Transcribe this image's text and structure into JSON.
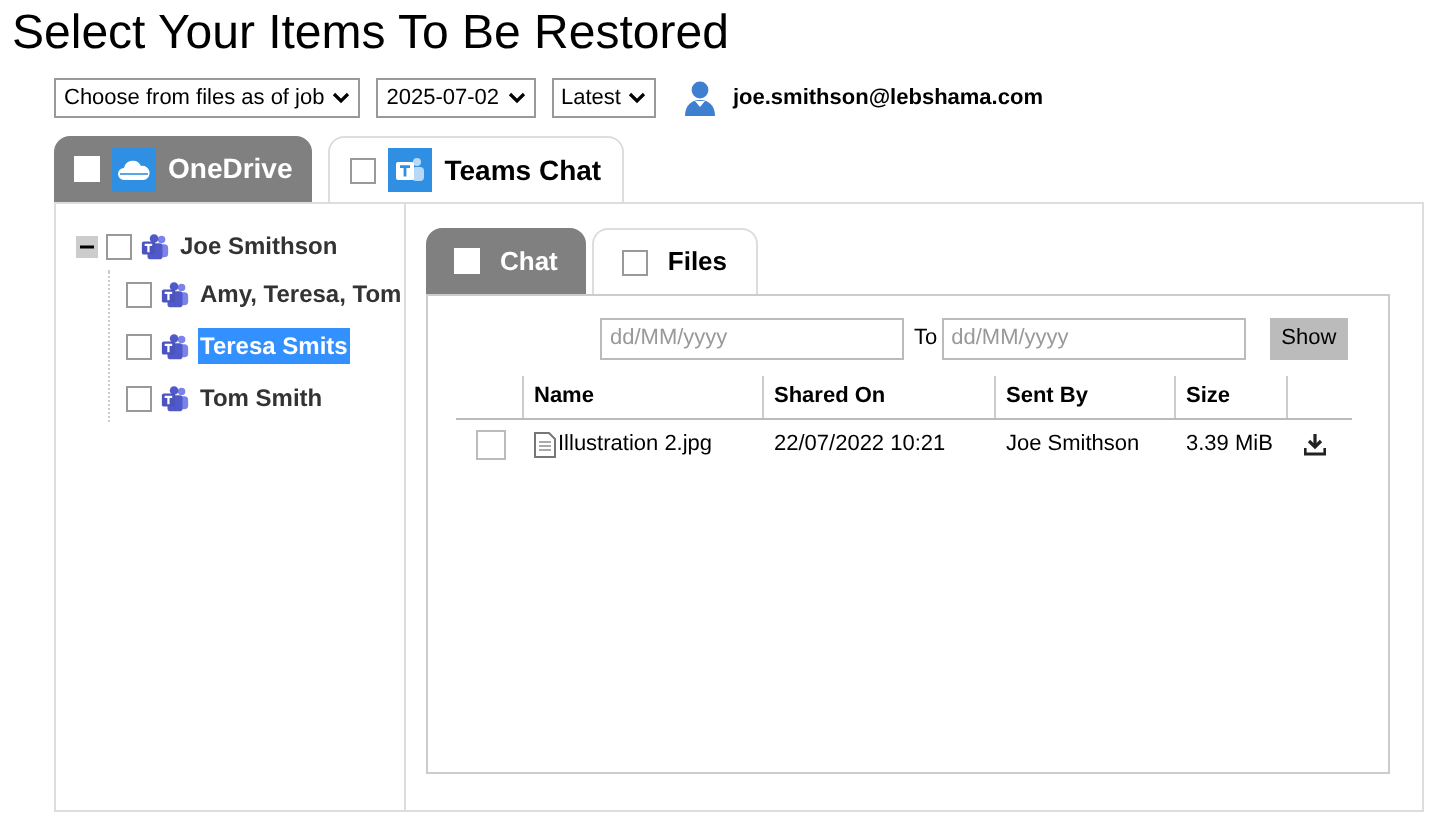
{
  "title": "Select Your Items To Be Restored",
  "filters": [
    {
      "value": "Choose from files as of job"
    },
    {
      "value": "2025-07-02"
    },
    {
      "value": "Latest"
    }
  ],
  "user": {
    "email": "joe.smithson@lebshama.com"
  },
  "tabs": [
    {
      "label": "OneDrive",
      "kind": "onedrive",
      "selected": false,
      "checked": false
    },
    {
      "label": "Teams Chat",
      "kind": "teams",
      "selected": true,
      "checked": false
    }
  ],
  "tree": [
    {
      "label": "Joe Smithson",
      "expanded": true,
      "checked": false,
      "selected": false,
      "children": [
        {
          "label": "Amy, Teresa, Tom",
          "checked": false,
          "selected": false
        },
        {
          "label": "Teresa Smits",
          "checked": false,
          "selected": true
        },
        {
          "label": "Tom Smith",
          "checked": false,
          "selected": false
        }
      ]
    }
  ],
  "subtabs": [
    {
      "label": "Chat",
      "selected": false,
      "checked": false
    },
    {
      "label": "Files",
      "selected": true,
      "checked": false
    }
  ],
  "date_from": {
    "placeholder": "dd/MM/yyyy"
  },
  "date_to": {
    "label": "To",
    "placeholder": "dd/MM/yyyy"
  },
  "show_button": "Show",
  "table": {
    "columns": [
      "Name",
      "Shared On",
      "Sent By",
      "Size"
    ],
    "rows": [
      {
        "checked": false,
        "name": "Illustration 2.jpg",
        "shared_on": "22/07/2022 10:21",
        "sent_by": "Joe Smithson",
        "size": "3.39 MiB"
      }
    ]
  }
}
